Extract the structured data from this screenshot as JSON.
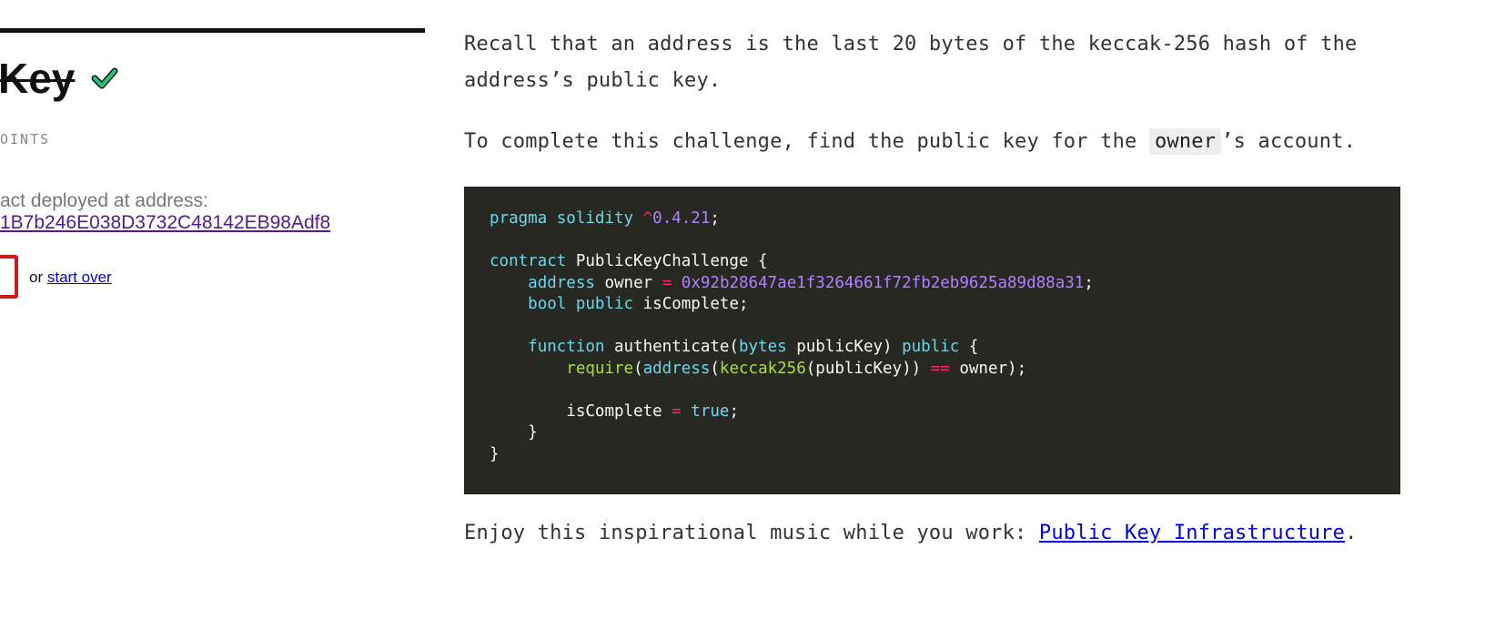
{
  "challenge": {
    "title": "Key",
    "points_label": "OINTS",
    "deployed_label": "act deployed at address:",
    "address": "1B7b246E038D3732C48142EB98Adf8",
    "or_text": "or",
    "start_over_label": "start over"
  },
  "description": {
    "p1": "Recall that an address is the last 20 bytes of the keccak-256 hash of the address’s public key.",
    "p2_before": "To complete this challenge, find the public key for the ",
    "p2_code": "owner",
    "p2_after": "’s account.",
    "p3_before": "Enjoy this inspirational music while you work: ",
    "p3_link": "Public Key Infrastructure",
    "p3_after": "."
  },
  "code": {
    "t1": "pragma",
    "t2": "solidity",
    "t3": "^",
    "t4": "0.4",
    "t5": ".21",
    "t6": ";",
    "t7": "contract",
    "t8": "PublicKeyChallenge {",
    "t9": "address",
    "t10": "owner",
    "t11": "=",
    "t12": "0x92b28647ae1f3264661f72fb2eb9625a89d88a31",
    "t13": ";",
    "t14": "bool",
    "t15": "public",
    "t16": "isComplete;",
    "t17": "function",
    "t18": "authenticate(",
    "t19": "bytes",
    "t20": "publicKey)",
    "t21": "public",
    "t22": "{",
    "t23": "require",
    "t24": "(",
    "t25": "address",
    "t26": "(",
    "t27": "keccak256",
    "t28": "(publicKey))",
    "t29": "==",
    "t30": "owner);",
    "t31": "isComplete",
    "t32": "=",
    "t33": "true",
    "t34": ";",
    "t35": "}",
    "t36": "}"
  },
  "colors": {
    "code_bg": "#272822",
    "keyword": "#66d9ef",
    "operator": "#f92672",
    "number": "#ae81ff",
    "function": "#a6e22e",
    "error_border": "#d11a1a",
    "check_icon": "#21c47b"
  },
  "icons": {
    "solved": "check-icon"
  }
}
